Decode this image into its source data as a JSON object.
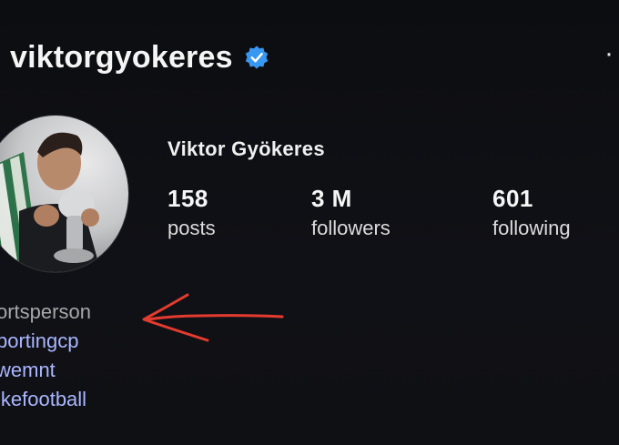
{
  "profile": {
    "username": "viktorgyokeres",
    "full_name": "Viktor Gyökeres",
    "verified_icon": "verified-badge-icon",
    "menu_icon": "more-dot-icon"
  },
  "stats": {
    "posts_count": "158",
    "posts_label": "posts",
    "followers_count": "3 M",
    "followers_label": "followers",
    "following_count": "601",
    "following_label": "following"
  },
  "bio": {
    "category": "ortsperson",
    "tags": [
      "portingcp",
      "wemnt",
      "ikefootball"
    ]
  },
  "colors": {
    "background": "#0d0e12",
    "text_primary": "#f2f2f2",
    "category_text": "#a7a7ab",
    "link_text": "#a9b6ff",
    "verified_blue": "#3897f0",
    "annotation_red": "#e33b2f"
  }
}
